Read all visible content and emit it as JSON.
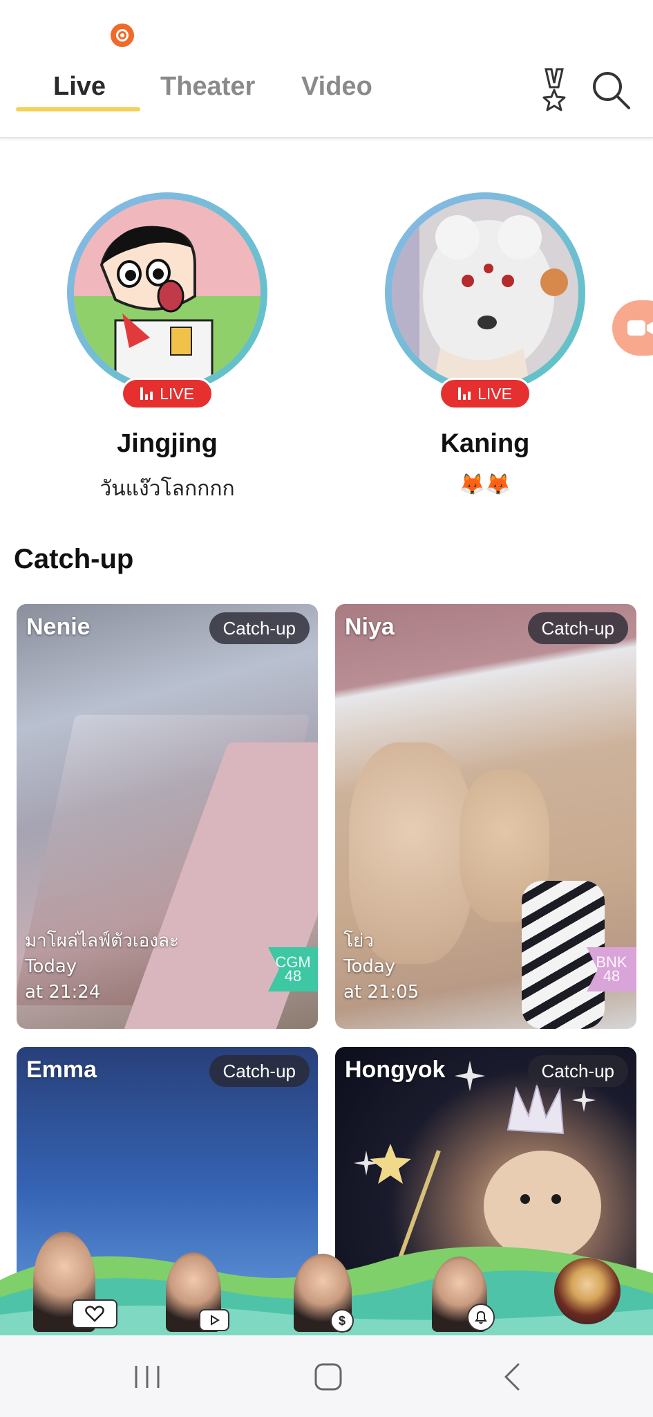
{
  "header": {
    "tabs": [
      {
        "label": "Live",
        "active": true
      },
      {
        "label": "Theater",
        "active": false
      },
      {
        "label": "Video",
        "active": false
      }
    ],
    "icons": [
      "record-live-icon",
      "ranking-medal-icon",
      "search-icon"
    ],
    "accent_color": "#f5d155"
  },
  "live": {
    "members": [
      {
        "name": "Jingjing",
        "status": "วันแง๊วโลกกกก",
        "badge": "LIVE"
      },
      {
        "name": "Kaning",
        "status": "🦊🦊",
        "badge": "LIVE"
      }
    ],
    "badge_color": "#e63030"
  },
  "catchup": {
    "title": "Catch-up",
    "cards": [
      {
        "name": "Nenie",
        "tag": "Catch-up",
        "caption": "มาโผล่ไลฟ์ตัวเองละ",
        "day": "Today",
        "time": "at 21:24",
        "group": "CGM 48"
      },
      {
        "name": "Niya",
        "tag": "Catch-up",
        "caption": "โย่ว",
        "day": "Today",
        "time": "at 21:05",
        "group": "BNK 48"
      },
      {
        "name": "Emma",
        "tag": "Catch-up"
      },
      {
        "name": "Hongyok",
        "tag": "Catch-up"
      }
    ]
  },
  "bottom_stage": {
    "icons": [
      "heart-icon",
      "play-video-icon",
      "coin-icon",
      "bell-icon"
    ]
  },
  "system_nav": [
    "recent-apps-icon",
    "home-icon",
    "back-icon"
  ]
}
